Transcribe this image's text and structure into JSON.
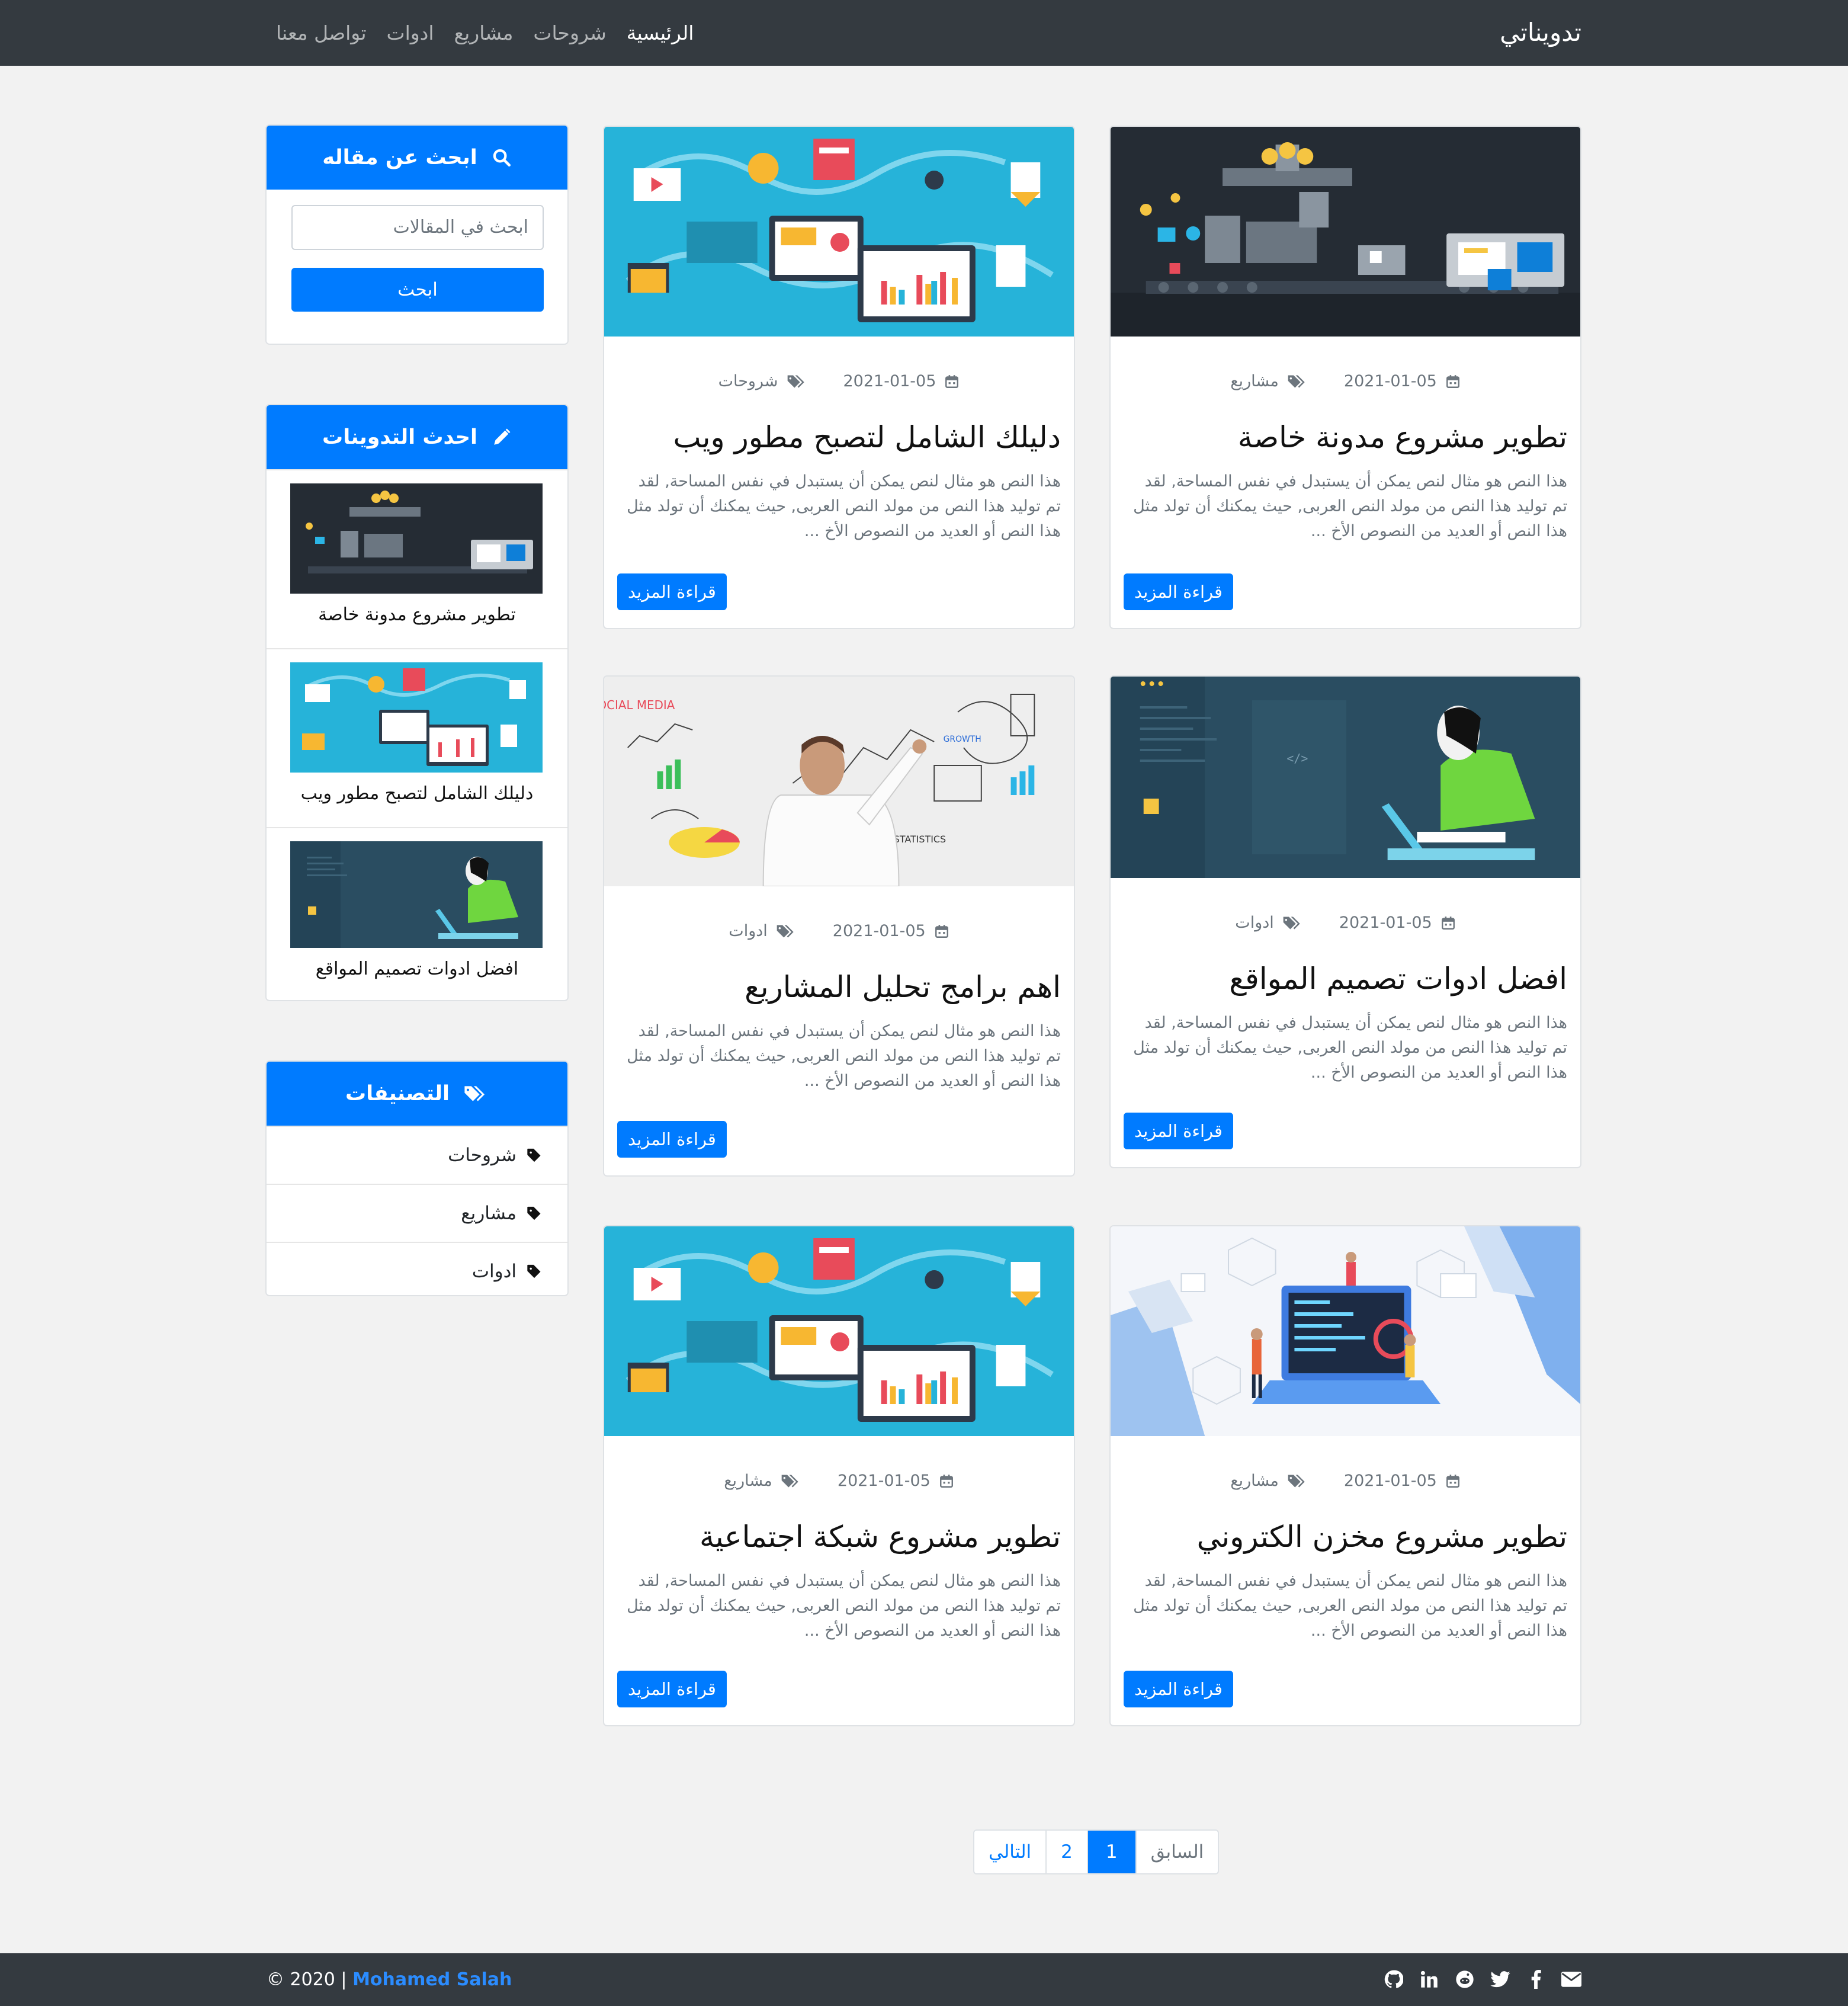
{
  "nav": {
    "brand": "تدويناتي",
    "links": [
      "الرئيسية",
      "شروحات",
      "مشاريع",
      "ادوات",
      "تواصل معنا"
    ]
  },
  "posts": [
    {
      "title": "تطوير مشروع مدونة خاصة",
      "date": "2021-01-05",
      "category": "مشاريع",
      "image": "factory",
      "more": "قراءة المزيد"
    },
    {
      "title": "دليلك الشامل لتصبح مطور ويب",
      "date": "2021-01-05",
      "category": "شروحات",
      "image": "blue-dashboard",
      "more": "قراءة المزيد"
    },
    {
      "title": "افضل ادوات تصميم المواقع",
      "date": "2021-01-05",
      "category": "ادوات",
      "image": "developer-laptop",
      "more": "قراءة المزيد"
    },
    {
      "title": "اهم برامج تحليل المشاريع",
      "date": "2021-01-05",
      "category": "ادوات",
      "image": "whiteboard-analytics",
      "more": "قراءة المزيد"
    },
    {
      "title": "تطوير مشروع مخزن الكتروني",
      "date": "2021-01-05",
      "category": "مشاريع",
      "image": "team-laptop",
      "more": "قراءة المزيد"
    },
    {
      "title": "تطوير مشروع شبكة اجتماعية",
      "date": "2021-01-05",
      "category": "مشاريع",
      "image": "blue-dashboard",
      "more": "قراءة المزيد"
    }
  ],
  "excerpt_lines": [
    "هذا النص هو مثال لنص يمكن أن يستبدل في نفس المساحة, لقد",
    "تم توليد هذا النص من مولد النص العربى, حيث يمكنك أن تولد مثل",
    "هذا النص أو العديد من النصوص الأخ ..."
  ],
  "sidebar": {
    "search": {
      "title": "ابحث عن مقاله",
      "placeholder": "ابحث في المقالات",
      "button": "ابحث"
    },
    "latest": {
      "title": "احدث التدوينات",
      "items": [
        "تطوير مشروع مدونة خاصة",
        "دليلك الشامل لتصبح مطور ويب",
        "افضل ادوات تصميم المواقع"
      ]
    },
    "categories": {
      "title": "التصنيفات",
      "items": [
        "شروحات",
        "مشاريع",
        "ادوات"
      ]
    }
  },
  "pagination": {
    "prev": "السابق",
    "pages": [
      "1",
      "2"
    ],
    "next": "التالي",
    "active": "1"
  },
  "footer": {
    "copyright": "© 2020 |",
    "author": "Mohamed Salah",
    "socials": [
      "envelope-icon",
      "facebook-icon",
      "twitter-icon",
      "reddit-icon",
      "linkedin-icon",
      "github-icon"
    ]
  },
  "colors": {
    "primary": "#007bff",
    "navbar": "#343a40",
    "background": "#f2f2f2"
  }
}
